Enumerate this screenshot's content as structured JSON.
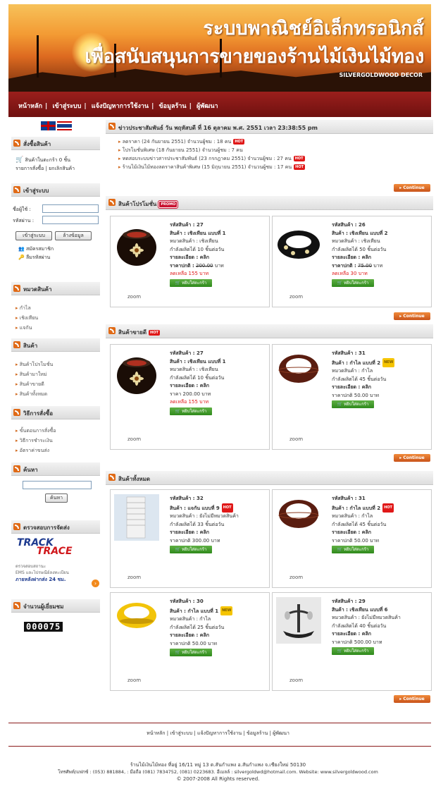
{
  "banner": {
    "title_line1": "ระบบพาณิชย์อิเล็กทรอนิกส์",
    "title_line2": "เพื่อสนับสนุนการขายของร้านไม้เงินไม้ทอง",
    "subtitle": "SILVERGOLDWOOD DECOR"
  },
  "nav": {
    "items": [
      "หน้าหลัก",
      "เข้าสู่ระบบ",
      "แจ้งปัญหาการใช้งาน",
      "ข้อมูลร้าน",
      "ผู้พัฒนา"
    ]
  },
  "sidebar": {
    "cart": {
      "title": "สั่งซื้อสินค้า",
      "line1": "สินค้าในตะกร้า 0 ชิ้น",
      "line2": "รายการสั่งซื้อ | ยกเลิกสินค้า"
    },
    "login": {
      "title": "เข้าสู่ระบบ",
      "user_label": "ชื่อผู้ใช้ :",
      "pass_label": "รหัสผ่าน :",
      "login_button": "เข้าสู่ระบบ",
      "clear_button": "ล้างข้อมูล",
      "register": "สมัครสมาชิก",
      "forgot": "ลืมรหัสผ่าน"
    },
    "categories": {
      "title": "หมวดสินค้า",
      "items": [
        "กำไล",
        "เชิงเทียน",
        "แจกัน"
      ]
    },
    "products": {
      "title": "สินค้า",
      "items": [
        "สินค้าโปรโมชั่น",
        "สินค้ามาใหม่",
        "สินค้าขายดี",
        "สินค้าทั้งหมด"
      ]
    },
    "howto": {
      "title": "วิธีการสั่งซื้อ",
      "items": [
        "ขั้นตอนการสั่งซื้อ",
        "วิธีการชำระเงิน",
        "อัตราค่าขนส่ง"
      ]
    },
    "search": {
      "title": "ค้นหา",
      "button": "ค้นหา"
    },
    "tracking": {
      "title": "ตรวจสอบการจัดส่ง",
      "logo_top": "TRACK",
      "logo_bottom": "TRACE",
      "line1": "ตรวจสอบสถานะ",
      "line2": "EMS และไปรษณีย์ลงทะเบียน",
      "line3": "ภายหลังฝากส่ง 24 ชม."
    },
    "visitors": {
      "title": "จำนวนผู้เยี่ยมชม",
      "count": "000075"
    }
  },
  "news": {
    "title": "ข่าวประชาสัมพันธ์ วัน พฤหัสบดี ที่ 16 ตุลาคม พ.ศ. 2551 เวลา 23:38:55 pm",
    "items": [
      {
        "text": "ลดราคา (24 กันยายน 2551) จำนวนผู้ชม : 18 คน",
        "hot": true
      },
      {
        "text": "โปรโมชั่นพิเศษ (18 กันยายน 2551) จำนวนผู้ชม : 7 คน",
        "hot": false
      },
      {
        "text": "ทดสอบระบบข่าวสารประชาสัมพันธ์ (23 กรกฎาคม 2551) จำนวนผู้ชม : 27 คน",
        "hot": true
      },
      {
        "text": "ร้านไม้เงินไม้ทองลดราคาสินค้าพิเศษ (15 มิถุนายน 2551) จำนวนผู้ชม : 17 คน",
        "hot": true
      }
    ]
  },
  "labels": {
    "continue": "Continue",
    "zoom": "zoom",
    "add_to_cart": "หยิบใส่ตะกร้า",
    "hot": "HOT",
    "new": "NEW",
    "promo": "PROMO"
  },
  "sections": {
    "promo": "สินค้าโปรโมชั่น",
    "best": "สินค้าขายดี",
    "all": "สินค้าทั้งหมด"
  },
  "promo_products": [
    {
      "code": "รหัสสินค้า : 27",
      "name": "สินค้า : เชิงเทียน แบบที่ 1",
      "category": "หมวดสินค้า : เชิงเทียน",
      "capacity": "กำลังผลิตได้ 10 ชิ้นต่อวัน",
      "detail": "รายละเอียด : คลิก",
      "price_label": "ราคาปกติ :",
      "old_price": "200.00",
      "unit": "บาท",
      "special": "ลดเหลือ 155 บาท",
      "kind": "candle"
    },
    {
      "code": "รหัสสินค้า : 26",
      "name": "สินค้า : เชิงเทียน แบบที่ 2",
      "category": "หมวดสินค้า : เชิงเทียน",
      "capacity": "กำลังผลิตได้ 50 ชิ้นต่อวัน",
      "detail": "รายละเอียด : คลิก",
      "price_label": "ราคาปกติ :",
      "old_price": "75.00",
      "unit": "บาท",
      "special": "ลดเหลือ 30 บาท",
      "kind": "ring"
    }
  ],
  "best_products": [
    {
      "code": "รหัสสินค้า : 27",
      "name": "สินค้า : เชิงเทียน แบบที่ 1",
      "category": "หมวดสินค้า : เชิงเทียน",
      "capacity": "กำลังผลิตได้ 10 ชิ้นต่อวัน",
      "detail": "รายละเอียด : คลิก",
      "price": "ราคา 200.00 บาท",
      "special": "ลดเหลือ 155 บาท",
      "kind": "candle",
      "badge": ""
    },
    {
      "code": "รหัสสินค้า : 31",
      "name": "สินค้า : กำไล แบบที่ 2",
      "category": "หมวดสินค้า : กำไล",
      "capacity": "กำลังผลิตได้ 45 ชิ้นต่อวัน",
      "detail": "รายละเอียด : คลิก",
      "price": "ราคาปกติ 50.00 บาท",
      "special": "",
      "kind": "bangle",
      "badge": "new"
    }
  ],
  "all_products": [
    {
      "code": "รหัสสินค้า : 32",
      "name": "สินค้า : แจกัน แบบที่ 9",
      "category": "หมวดสินค้า : ยังไม่มีหมวดสินค้า",
      "capacity": "กำลังผลิตได้ 33 ชิ้นต่อวัน",
      "detail": "รายละเอียด : คลิก",
      "price": "ราคาปกติ 300.00 บาท",
      "kind": "vase",
      "badge": "hot"
    },
    {
      "code": "รหัสสินค้า : 31",
      "name": "สินค้า : กำไล แบบที่ 2",
      "category": "หมวดสินค้า : กำไล",
      "capacity": "กำลังผลิตได้ 45 ชิ้นต่อวัน",
      "detail": "รายละเอียด : คลิก",
      "price": "ราคาปกติ 50.00 บาท",
      "kind": "bangle",
      "badge": "hot"
    },
    {
      "code": "รหัสสินค้า : 30",
      "name": "สินค้า : กำไล แบบที่ 1",
      "category": "หมวดสินค้า : กำไล",
      "capacity": "กำลังผลิตได้ 25 ชิ้นต่อวัน",
      "detail": "รายละเอียด : คลิก",
      "price": "ราคาปกติ 50.00 บาท",
      "kind": "yellow",
      "badge": "new"
    },
    {
      "code": "รหัสสินค้า : 29",
      "name": "สินค้า : เชิงเทียน แบบที่ 6",
      "category": "หมวดสินค้า : ยังไม่มีหมวดสินค้า",
      "capacity": "กำลังผลิตได้ 40 ชิ้นต่อวัน",
      "detail": "รายละเอียด : คลิก",
      "price": "ราคาปกติ 500.00 บาท",
      "kind": "stand",
      "badge": ""
    }
  ],
  "footer": {
    "nav": "หน้าหลัก | เข้าสู่ระบบ | แจ้งปัญหาการใช้งาน | ข้อมูลร้าน | ผู้พัฒนา",
    "address": "ร้านไม้เงินไม้ทอง ที่อยู่ 16/11 หมู่ 13 ต.สันกำแพง อ.สันกำแพง จ.เชียงใหม่ 50130",
    "contact": "โทรศัพท์/แฟกซ์ : (053) 881884, : มือถือ (081) 7834752, (081) 0223683. อีเมลล์ : silvergoldwd@hotmail.com. Website: www.silvergoldwood.com",
    "copyright": "© 2007-2008 All Rights reserved."
  },
  "colors": {
    "nav_red": "#8a1b1b",
    "accent_orange": "#e06a16",
    "cart_green": "#3a9a26",
    "hot_red": "#e01818"
  }
}
